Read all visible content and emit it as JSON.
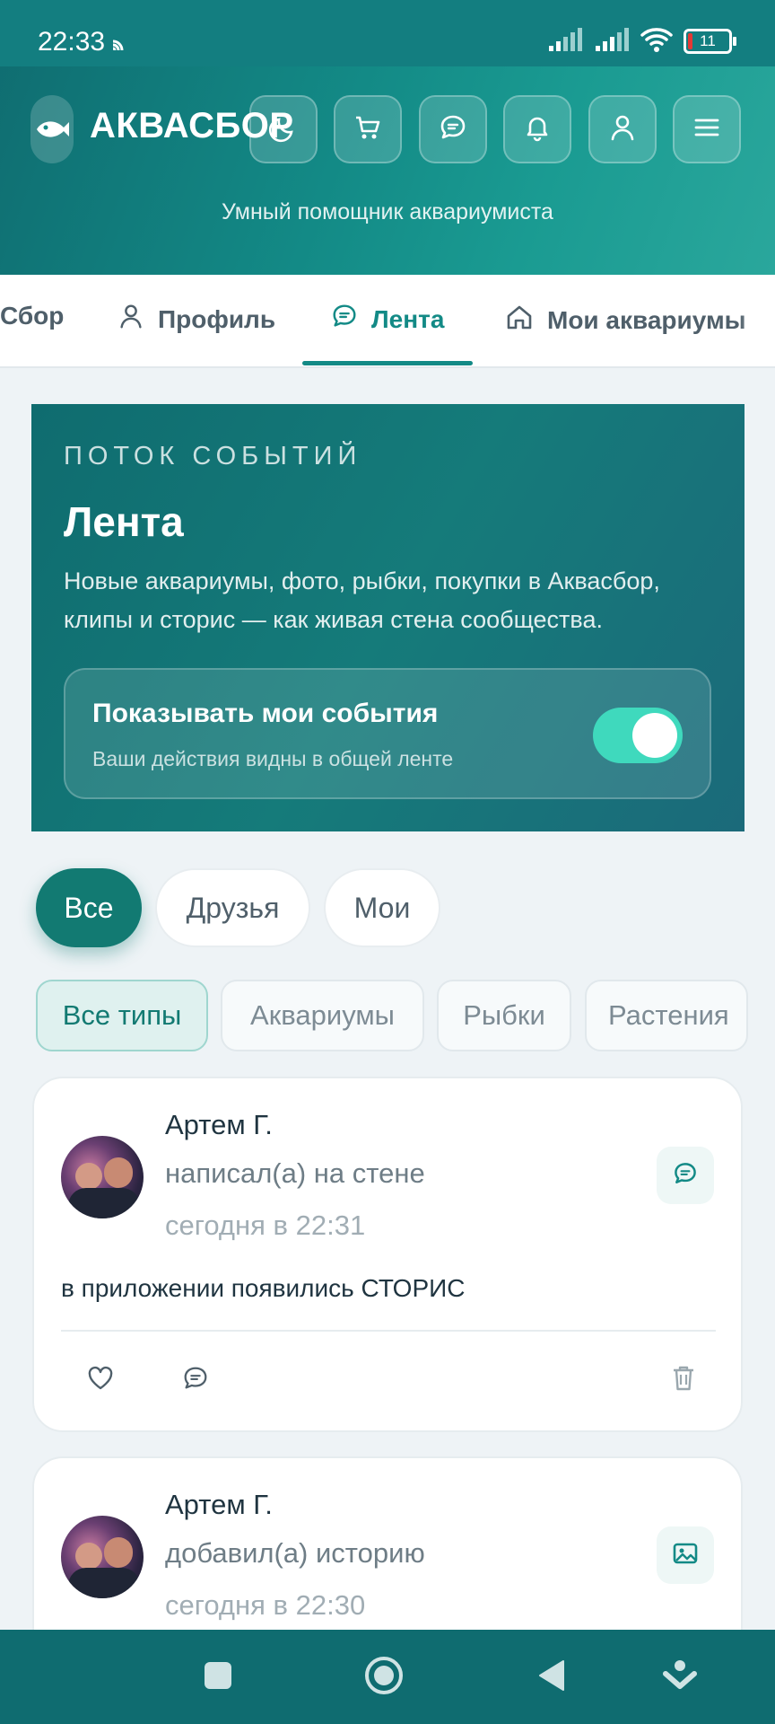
{
  "status_bar": {
    "time": "22:33",
    "battery": "11",
    "icons": [
      "cast-icon",
      "signal-icon",
      "signal-icon",
      "wifi-icon",
      "battery-icon"
    ]
  },
  "header": {
    "brand": "АКВАСБОР",
    "subtitle": "Умный помощник аквариумиста",
    "buttons": [
      "moon-icon",
      "cart-icon",
      "chat-icon",
      "bell-icon",
      "user-icon",
      "menu-icon"
    ]
  },
  "tabs": [
    {
      "label": "Сбор",
      "icon": "none"
    },
    {
      "label": "Профиль",
      "icon": "user-icon"
    },
    {
      "label": "Лента",
      "icon": "chat-icon",
      "active": true
    },
    {
      "label": "Мои аквариумы",
      "icon": "home-icon"
    }
  ],
  "hero": {
    "eyebrow": "ПОТОК СОБЫТИЙ",
    "title": "Лента",
    "description": "Новые аквариумы, фото, рыбки, покупки в Аквасбор, клипы и сторис — как живая стена сообщества.",
    "toggle": {
      "title": "Показывать мои события",
      "subtitle": "Ваши действия видны в общей ленте",
      "on": true
    }
  },
  "audience_filters": [
    "Все",
    "Друзья",
    "Мои"
  ],
  "type_filters": [
    "Все типы",
    "Аквариумы",
    "Рыбки",
    "Растения"
  ],
  "posts": [
    {
      "author": "Артем Г.",
      "action": "написал(а) на стене",
      "time": "сегодня в 22:31",
      "text": "в приложении появились СТОРИС",
      "kind_icon": "chat-icon"
    },
    {
      "author": "Артем Г.",
      "action": "добавил(а) историю",
      "time": "сегодня в 22:30",
      "kind_icon": "image-icon"
    }
  ],
  "colors": {
    "brand": "#138a86",
    "brand_dark": "#0f6c70",
    "toggle_on": "#3fd9bd"
  }
}
